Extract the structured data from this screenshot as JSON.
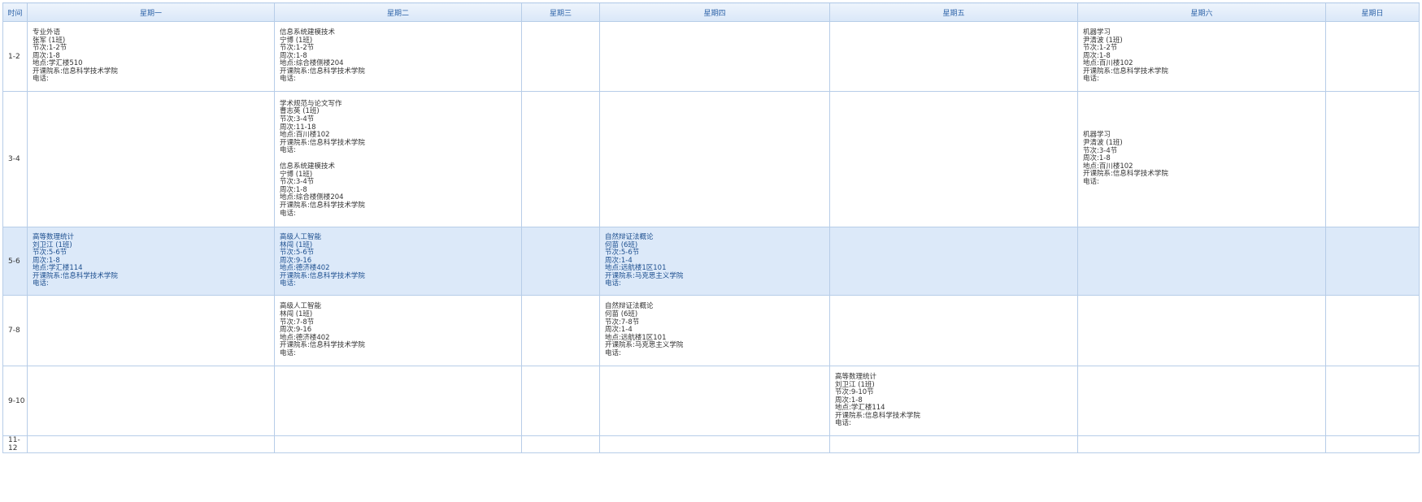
{
  "header": {
    "time": "时间",
    "days": [
      "星期一",
      "星期二",
      "星期三",
      "星期四",
      "星期五",
      "星期六",
      "星期日"
    ]
  },
  "rows": [
    {
      "label": "1-2",
      "cells": [
        [
          {
            "name": "专业外语",
            "teacher": "张军 (1班)",
            "section": "节次:1-2节",
            "weeks": "周次:1-8",
            "location": "地点:学汇楼510",
            "dept": "开课院系:信息科学技术学院",
            "phone": "电话:"
          }
        ],
        [
          {
            "name": "信息系统建模技术",
            "teacher": "宁博 (1班)",
            "section": "节次:1-2节",
            "weeks": "周次:1-8",
            "location": "地点:综合楼侧楼204",
            "dept": "开课院系:信息科学技术学院",
            "phone": "电话:"
          }
        ],
        [],
        [],
        [],
        [
          {
            "name": "机器学习",
            "teacher": "尹清波 (1班)",
            "section": "节次:1-2节",
            "weeks": "周次:1-8",
            "location": "地点:百川楼102",
            "dept": "开课院系:信息科学技术学院",
            "phone": "电话:"
          }
        ],
        []
      ]
    },
    {
      "label": "3-4",
      "cells": [
        [],
        [
          {
            "name": "学术规范与论文写作",
            "teacher": "曹志英 (1班)",
            "section": "节次:3-4节",
            "weeks": "周次:11-18",
            "location": "地点:百川楼102",
            "dept": "开课院系:信息科学技术学院",
            "phone": "电话:"
          },
          {
            "name": "信息系统建模技术",
            "teacher": "宁博 (1班)",
            "section": "节次:3-4节",
            "weeks": "周次:1-8",
            "location": "地点:综合楼侧楼204",
            "dept": "开课院系:信息科学技术学院",
            "phone": "电话:"
          }
        ],
        [],
        [],
        [],
        [
          {
            "name": "机器学习",
            "teacher": "尹清波 (1班)",
            "section": "节次:3-4节",
            "weeks": "周次:1-8",
            "location": "地点:百川楼102",
            "dept": "开课院系:信息科学技术学院",
            "phone": "电话:"
          }
        ],
        []
      ]
    },
    {
      "label": "5-6",
      "highlight": true,
      "cells": [
        [
          {
            "name": "高等数理统计",
            "teacher": "刘卫江 (1班)",
            "section": "节次:5-6节",
            "weeks": "周次:1-8",
            "location": "地点:学汇楼114",
            "dept": "开课院系:信息科学技术学院",
            "phone": "电话:"
          }
        ],
        [
          {
            "name": "高级人工智能",
            "teacher": "林闯 (1班)",
            "section": "节次:5-6节",
            "weeks": "周次:9-16",
            "location": "地点:德济楼402",
            "dept": "开课院系:信息科学技术学院",
            "phone": "电话:"
          }
        ],
        [],
        [
          {
            "name": "自然辩证法概论",
            "teacher": "何苗 (6班)",
            "section": "节次:5-6节",
            "weeks": "周次:1-4",
            "location": "地点:远航楼1区101",
            "dept": "开课院系:马克思主义学院",
            "phone": "电话:"
          }
        ],
        [],
        [],
        []
      ]
    },
    {
      "label": "7-8",
      "cells": [
        [],
        [
          {
            "name": "高级人工智能",
            "teacher": "林闯 (1班)",
            "section": "节次:7-8节",
            "weeks": "周次:9-16",
            "location": "地点:德济楼402",
            "dept": "开课院系:信息科学技术学院",
            "phone": "电话:"
          }
        ],
        [],
        [
          {
            "name": "自然辩证法概论",
            "teacher": "何苗 (6班)",
            "section": "节次:7-8节",
            "weeks": "周次:1-4",
            "location": "地点:远航楼1区101",
            "dept": "开课院系:马克思主义学院",
            "phone": "电话:"
          }
        ],
        [],
        [],
        []
      ]
    },
    {
      "label": "9-10",
      "cells": [
        [],
        [],
        [],
        [],
        [
          {
            "name": "高等数理统计",
            "teacher": "刘卫江 (1班)",
            "section": "节次:9-10节",
            "weeks": "周次:1-8",
            "location": "地点:学汇楼114",
            "dept": "开课院系:信息科学技术学院",
            "phone": "电话:"
          }
        ],
        [],
        []
      ]
    },
    {
      "label": "11-12",
      "cells": [
        [],
        [],
        [],
        [],
        [],
        [],
        []
      ]
    }
  ]
}
